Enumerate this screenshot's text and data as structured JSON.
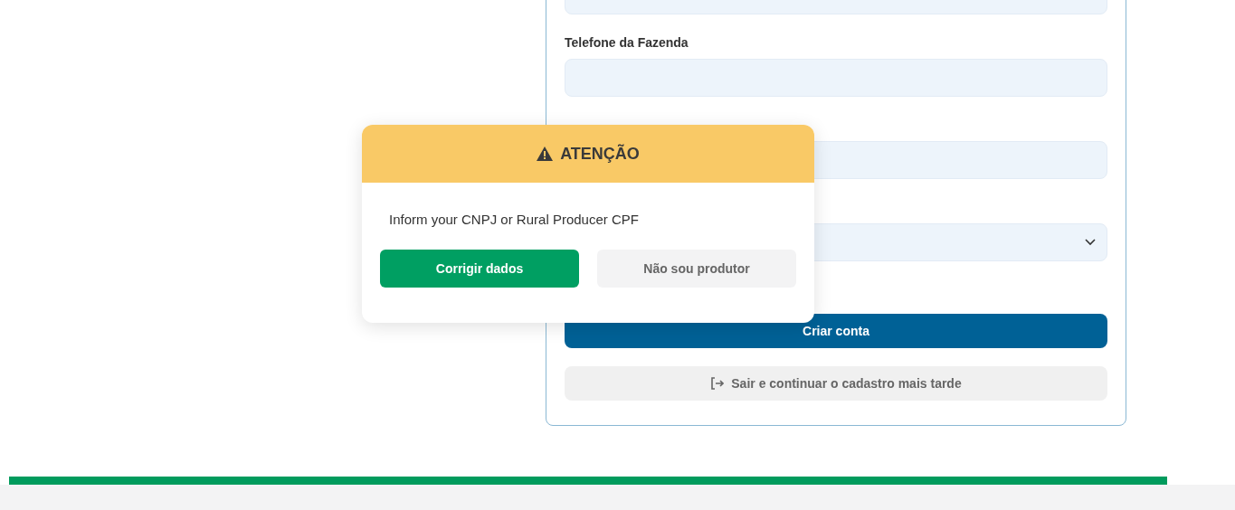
{
  "form": {
    "fields": [
      {
        "kind": "input"
      },
      {
        "kind": "input",
        "label": "Telefone da Fazenda"
      },
      {
        "kind": "input"
      },
      {
        "kind": "select"
      }
    ],
    "primary_button": "Criar conta",
    "secondary_button": "Sair e continuar o cadastro mais tarde"
  },
  "dialog": {
    "title": "ATENÇÃO",
    "message": "Inform your CNPJ or Rural Producer CPF",
    "buttons": [
      {
        "label": "Corrigir dados",
        "kind": "primary"
      },
      {
        "label": "Não sou produtor",
        "kind": "secondary"
      }
    ]
  }
}
